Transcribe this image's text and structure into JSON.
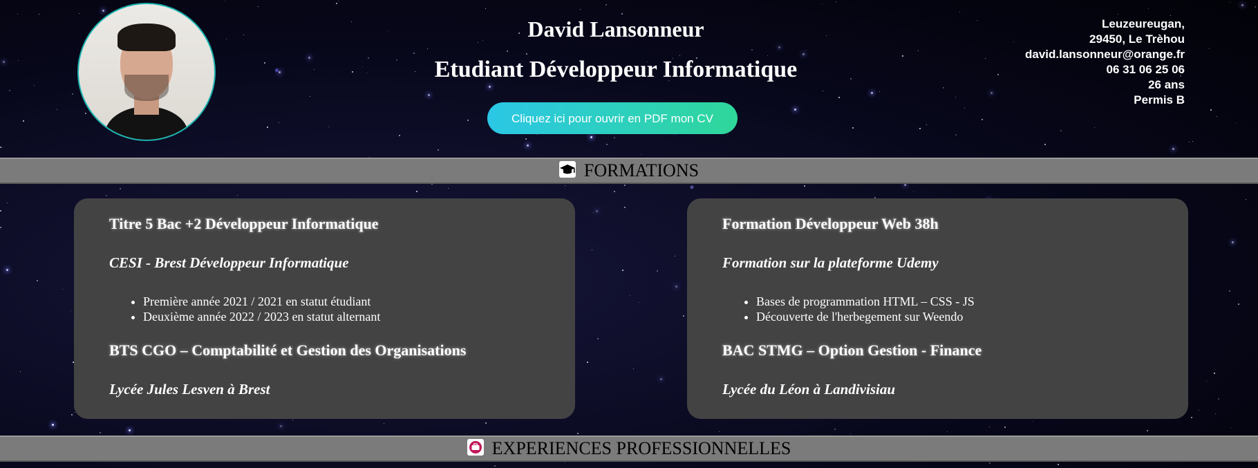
{
  "header": {
    "name": "David Lansonneur",
    "job_title": "Etudiant Développeur Informatique",
    "cv_button_label": "Cliquez ici pour ouvrir en PDF mon CV",
    "contact": [
      "Leuzeureugan,",
      "29450, Le Trèhou",
      "david.lansonneur@orange.fr",
      "06 31 06 25 06",
      "26 ans",
      "Permis B"
    ]
  },
  "sections": {
    "formations": {
      "title": "FORMATIONS",
      "icon": "graduation-cap-icon"
    },
    "experiences": {
      "title": "EXPERIENCES PROFESSIONNELLES",
      "icon": "briefcase-icon"
    }
  },
  "formations": [
    {
      "title": "Titre 5 Bac +2 Développeur Informatique",
      "school": "CESI - Brest Développeur Informatique",
      "items": [
        "Première année 2021 / 2021 en statut étudiant",
        "Deuxième année 2022 / 2023 en statut alternant"
      ],
      "title2": "BTS CGO – Comptabilité et Gestion des Organisations",
      "school2": "Lycée Jules Lesven à Brest"
    },
    {
      "title": "Formation Développeur Web 38h",
      "school": "Formation sur la plateforme Udemy",
      "items": [
        "Bases de programmation HTML – CSS - JS",
        "Découverte de l'herbegement sur Weendo"
      ],
      "title2": "BAC STMG – Option Gestion - Finance",
      "school2": "Lycée du Léon à Landivisiau"
    }
  ],
  "colors": {
    "accent_gradient_start": "#2bc7e6",
    "accent_gradient_end": "#2fd79a",
    "section_bar": "#7b7b7b",
    "card": "#444344",
    "avatar_border": "#1bb3b0"
  }
}
